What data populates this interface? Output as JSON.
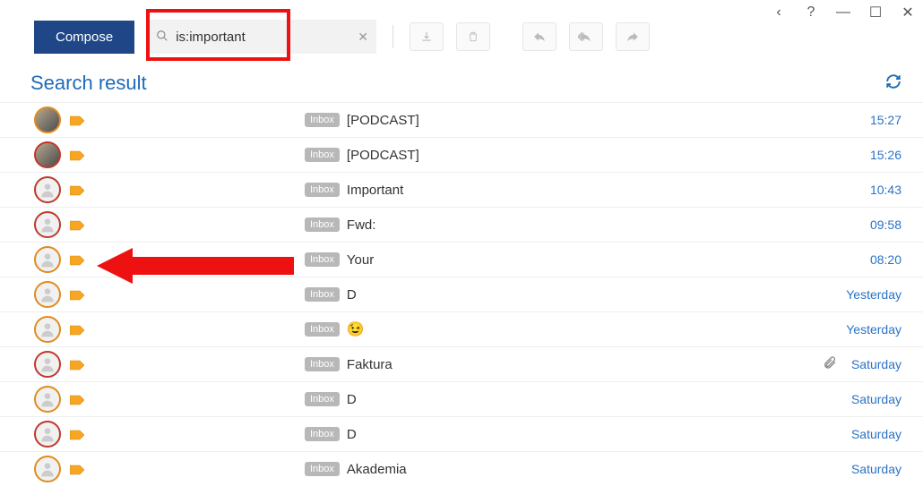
{
  "window": {
    "prev": "‹",
    "help": "?",
    "min": "—",
    "max": "☐",
    "close": "✕"
  },
  "toolbar": {
    "compose_label": "Compose",
    "search_value": "is:important"
  },
  "heading": "Search result",
  "inbox_chip": "Inbox",
  "emails": [
    {
      "avatar": "photo",
      "ring": "orange",
      "subject": "[PODCAST]",
      "time": "15:27",
      "attach": false
    },
    {
      "avatar": "photo",
      "ring": "red",
      "subject": "[PODCAST]",
      "time": "15:26",
      "attach": false
    },
    {
      "avatar": "person",
      "ring": "red",
      "subject": "Important",
      "time": "10:43",
      "attach": false
    },
    {
      "avatar": "person",
      "ring": "red",
      "subject": "Fwd:",
      "time": "09:58",
      "attach": false
    },
    {
      "avatar": "person",
      "ring": "orange",
      "subject": "Your",
      "time": "08:20",
      "attach": false
    },
    {
      "avatar": "person",
      "ring": "orange",
      "subject": "D",
      "time": "Yesterday",
      "attach": false
    },
    {
      "avatar": "person",
      "ring": "orange",
      "subject_emoji": "😉",
      "time": "Yesterday",
      "attach": false
    },
    {
      "avatar": "person",
      "ring": "red",
      "subject": "Faktura",
      "time": "Saturday",
      "attach": true
    },
    {
      "avatar": "person",
      "ring": "orange",
      "subject": "D",
      "time": "Saturday",
      "attach": false
    },
    {
      "avatar": "person",
      "ring": "red",
      "subject": "D",
      "time": "Saturday",
      "attach": false
    },
    {
      "avatar": "person",
      "ring": "orange",
      "subject": "Akademia",
      "time": "Saturday",
      "attach": false
    }
  ]
}
